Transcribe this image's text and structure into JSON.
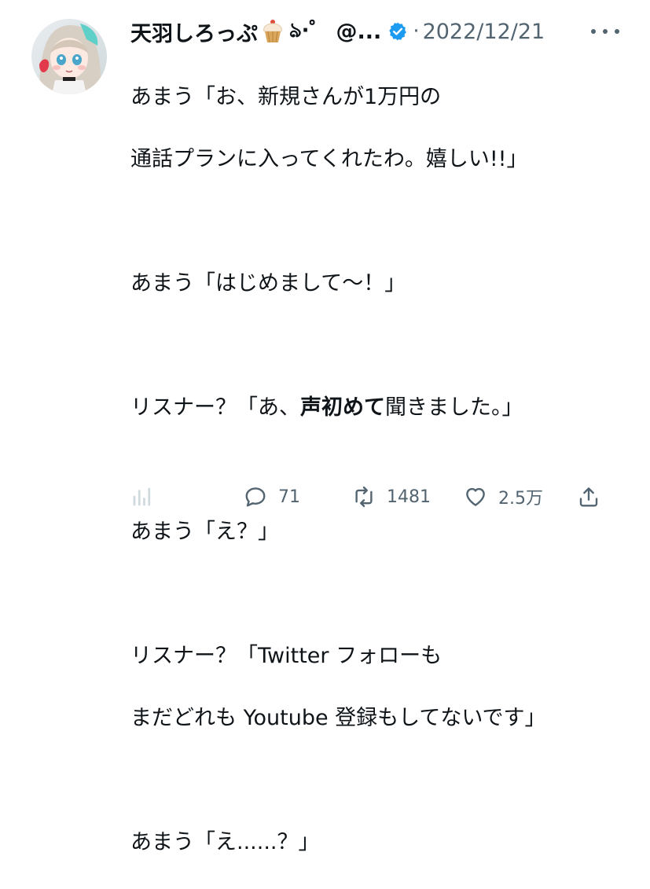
{
  "tweet": {
    "display_name": "天羽しろっぷ",
    "name_suffix": "ঌ·゜",
    "handle": "@...",
    "separator": "·",
    "date": "2022/12/21",
    "lines": [
      "あまう「お、新規さんが1万円の",
      "通話プランに入ってくれたわ。嬉しい!!」",
      "",
      "あまう「はじめまして〜！」",
      "",
      "リスナー？「あ、",
      "声初めて",
      "聞きました。」",
      "",
      "あまう「え？」",
      "",
      "リスナー？「Twitter フォローも",
      "まだどれも Youtube 登録もしてないです」",
      "",
      "あまう「え......？」"
    ]
  },
  "actions": {
    "reply_count": "71",
    "retweet_count": "1481",
    "like_count": "2.5万"
  },
  "icons": {
    "avatar": "avatar-image",
    "cupcake": "cupcake-emoji-icon",
    "verified": "verified-badge-icon",
    "more": "more-options-icon",
    "analytics": "analytics-icon",
    "reply": "reply-icon",
    "retweet": "retweet-icon",
    "like": "heart-icon",
    "share": "share-icon"
  },
  "colors": {
    "text": "#0f1419",
    "muted": "#536471",
    "verified": "#1d9bf0",
    "analytics_faded": "#cfd9de"
  }
}
